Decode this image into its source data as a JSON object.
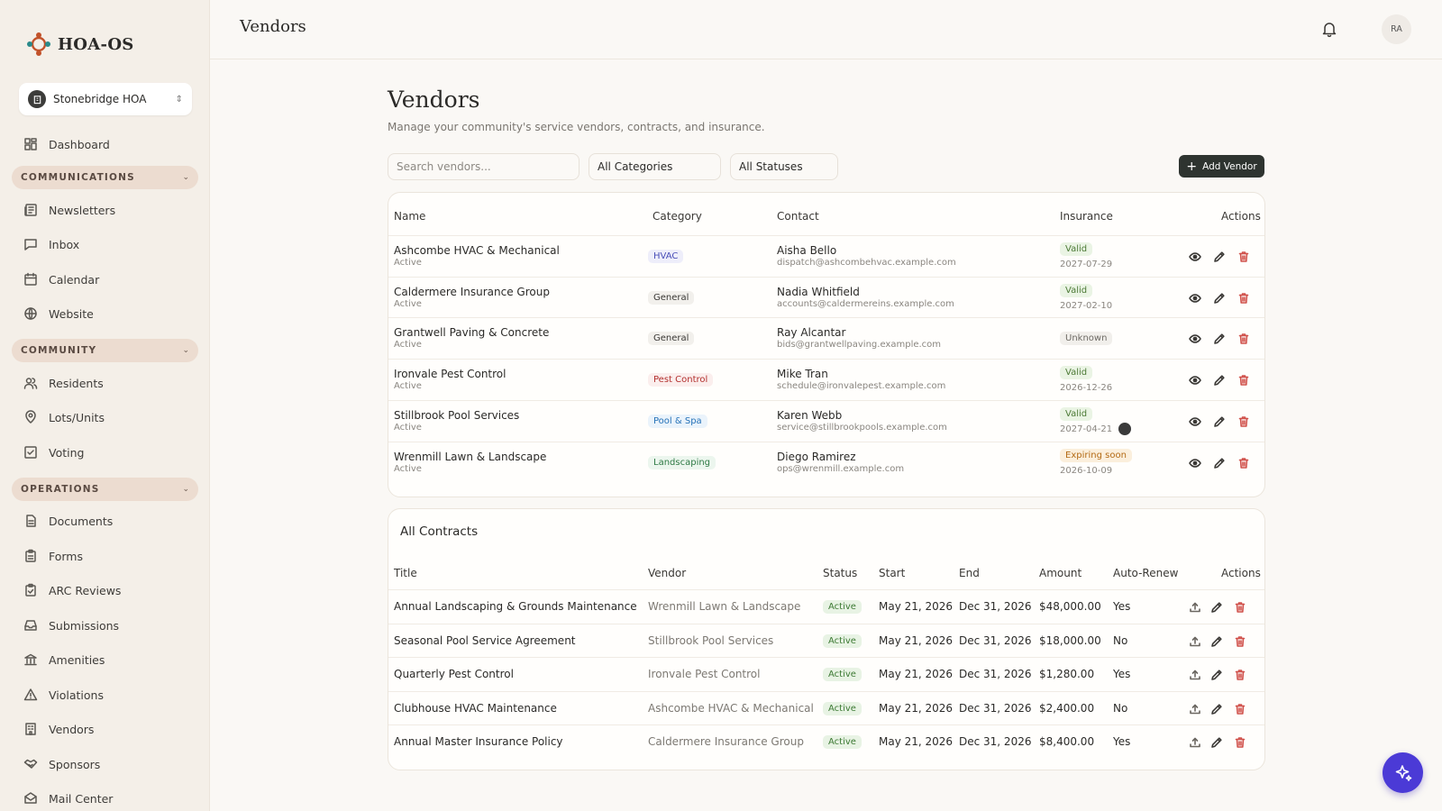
{
  "app": {
    "name": "HOA-OS"
  },
  "org": {
    "name": "Stonebridge HOA"
  },
  "header": {
    "title": "Vendors",
    "avatar_initials": "RA"
  },
  "sidebar": {
    "dashboard": "Dashboard",
    "sections": [
      {
        "label": "COMMUNICATIONS",
        "items": [
          "Newsletters",
          "Inbox",
          "Calendar",
          "Website"
        ]
      },
      {
        "label": "COMMUNITY",
        "items": [
          "Residents",
          "Lots/Units",
          "Voting"
        ]
      },
      {
        "label": "OPERATIONS",
        "items": [
          "Documents",
          "Forms",
          "ARC Reviews",
          "Submissions",
          "Amenities",
          "Violations",
          "Vendors",
          "Sponsors",
          "Mail Center"
        ]
      }
    ]
  },
  "page": {
    "title": "Vendors",
    "subtitle": "Manage your community's service vendors, contracts, and insurance.",
    "search_placeholder": "Search vendors...",
    "category_filter": "All Categories",
    "status_filter": "All Statuses",
    "add_label": "Add Vendor"
  },
  "vendors_table": {
    "headers": [
      "Name",
      "Category",
      "Contact",
      "Insurance",
      "Actions"
    ],
    "rows": [
      {
        "name": "Ashcombe HVAC & Mechanical",
        "status": "Active",
        "category": "HVAC",
        "contact": "Aisha Bello",
        "email": "dispatch@ashcombehvac.example.com",
        "insurance": "Valid",
        "insurance_date": "2027-07-29"
      },
      {
        "name": "Caldermere Insurance Group",
        "status": "Active",
        "category": "General",
        "contact": "Nadia Whitfield",
        "email": "accounts@caldermereins.example.com",
        "insurance": "Valid",
        "insurance_date": "2027-02-10"
      },
      {
        "name": "Grantwell Paving & Concrete",
        "status": "Active",
        "category": "General",
        "contact": "Ray Alcantar",
        "email": "bids@grantwellpaving.example.com",
        "insurance": "Unknown",
        "insurance_date": ""
      },
      {
        "name": "Ironvale Pest Control",
        "status": "Active",
        "category": "Pest Control",
        "contact": "Mike Tran",
        "email": "schedule@ironvalepest.example.com",
        "insurance": "Valid",
        "insurance_date": "2026-12-26"
      },
      {
        "name": "Stillbrook Pool Services",
        "status": "Active",
        "category": "Pool & Spa",
        "contact": "Karen Webb",
        "email": "service@stillbrookpools.example.com",
        "insurance": "Valid",
        "insurance_date": "2027-04-21"
      },
      {
        "name": "Wrenmill Lawn & Landscape",
        "status": "Active",
        "category": "Landscaping",
        "contact": "Diego Ramirez",
        "email": "ops@wrenmill.example.com",
        "insurance": "Expiring soon",
        "insurance_date": "2026-10-09"
      }
    ]
  },
  "contracts_table": {
    "title": "All Contracts",
    "headers": [
      "Title",
      "Vendor",
      "Status",
      "Start",
      "End",
      "Amount",
      "Auto-Renew",
      "Actions"
    ],
    "rows": [
      {
        "title": "Annual Landscaping & Grounds Maintenance",
        "vendor": "Wrenmill Lawn & Landscape",
        "status": "Active",
        "start": "May 21, 2026",
        "end": "Dec 31, 2026",
        "amount": "$48,000.00",
        "auto_renew": "Yes"
      },
      {
        "title": "Seasonal Pool Service Agreement",
        "vendor": "Stillbrook Pool Services",
        "status": "Active",
        "start": "May 21, 2026",
        "end": "Dec 31, 2026",
        "amount": "$18,000.00",
        "auto_renew": "No"
      },
      {
        "title": "Quarterly Pest Control",
        "vendor": "Ironvale Pest Control",
        "status": "Active",
        "start": "May 21, 2026",
        "end": "Dec 31, 2026",
        "amount": "$1,280.00",
        "auto_renew": "Yes"
      },
      {
        "title": "Clubhouse HVAC Maintenance",
        "vendor": "Ashcombe HVAC & Mechanical",
        "status": "Active",
        "start": "May 21, 2026",
        "end": "Dec 31, 2026",
        "amount": "$2,400.00",
        "auto_renew": "No"
      },
      {
        "title": "Annual Master Insurance Policy",
        "vendor": "Caldermere Insurance Group",
        "status": "Active",
        "start": "May 21, 2026",
        "end": "Dec 31, 2026",
        "amount": "$8,400.00",
        "auto_renew": "Yes"
      }
    ]
  },
  "colors": {
    "accent": "#4b3ad6",
    "primary_button": "#2e3430",
    "logo": "#c2522a"
  }
}
